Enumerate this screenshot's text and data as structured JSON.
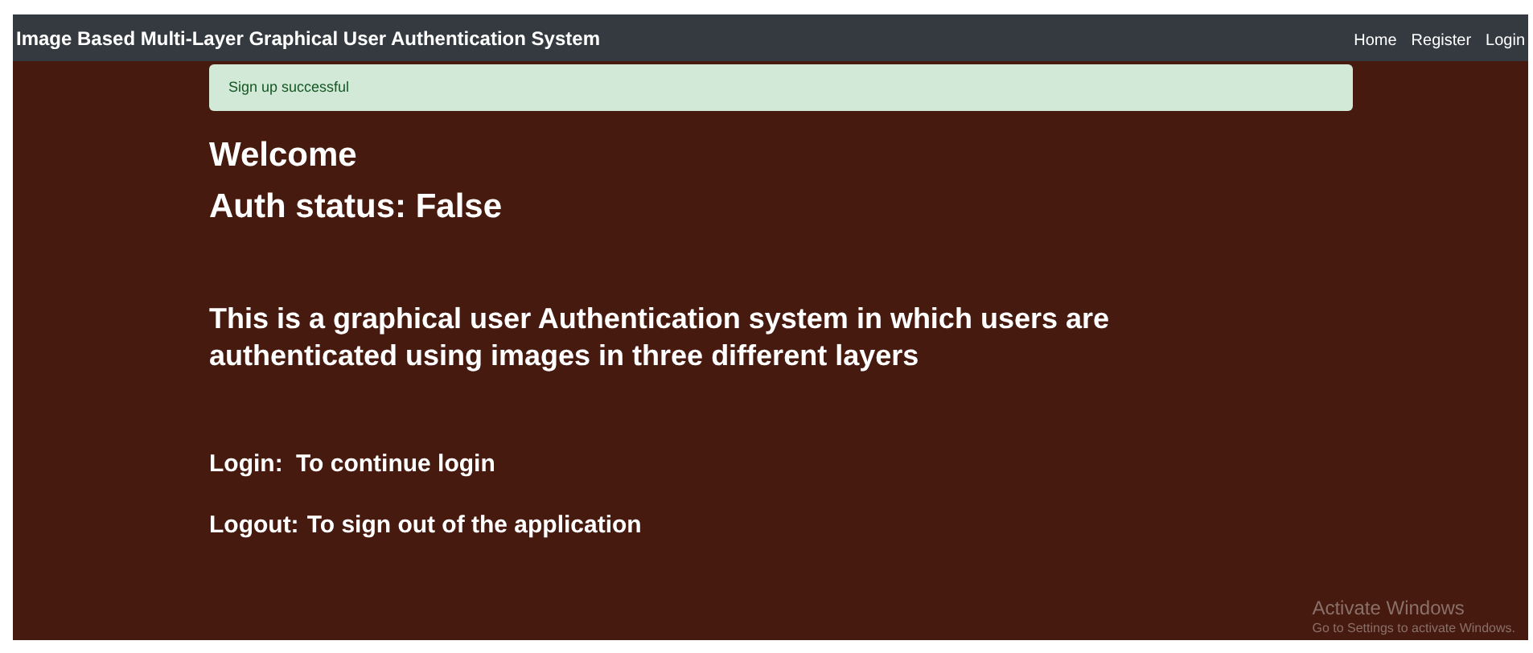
{
  "navbar": {
    "brand": "Image Based Multi-Layer Graphical User Authentication System",
    "links": [
      "Home",
      "Register",
      "Login"
    ]
  },
  "alert": {
    "text": "Sign up successful"
  },
  "headings": [
    "Welcome",
    "Auth status: False"
  ],
  "description": "This is a graphical user Authentication system in which users are authenticated using images in three different layers",
  "actions": [
    {
      "label": "Login:",
      "text": "To continue login"
    },
    {
      "label": "Logout:",
      "text": "To sign out of the application"
    }
  ],
  "activation_notice": {
    "title": "Activate Windows",
    "subtitle": "Go to Settings to activate Windows."
  }
}
